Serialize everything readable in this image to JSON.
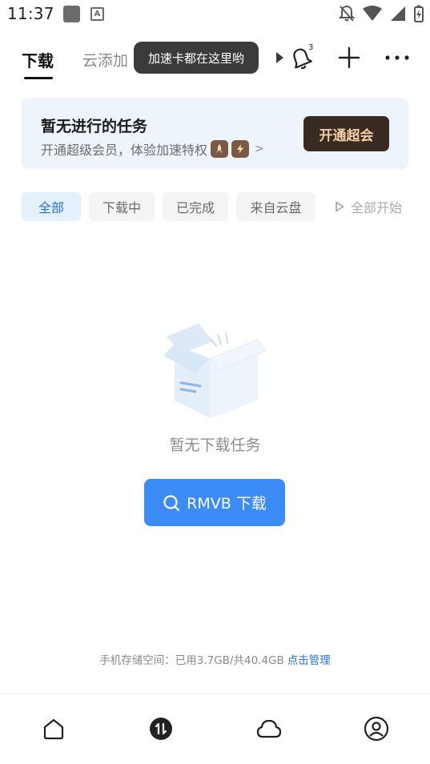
{
  "status_bar": {
    "time": "11:37",
    "app_icon_label": "A"
  },
  "tabs": {
    "active_label": "下载",
    "second_label": "云添加",
    "tooltip": "加速卡都在这里哟",
    "notification_count": "3"
  },
  "vip_banner": {
    "title": "暂无进行的任务",
    "subtitle": "开通超级会员，体验加速特权",
    "arrow": ">",
    "button_label": "开通超会"
  },
  "filters": {
    "items": [
      {
        "label": "全部",
        "active": true
      },
      {
        "label": "下载中",
        "active": false
      },
      {
        "label": "已完成",
        "active": false
      },
      {
        "label": "来自云盘",
        "active": false
      }
    ],
    "start_all_label": "全部开始"
  },
  "empty_state": {
    "message": "暂无下载任务",
    "search_label": "RMVB 下载"
  },
  "storage": {
    "text": "手机存储空间：已用3.7GB/共40.4GB",
    "manage_label": "点击管理"
  },
  "bottom_nav": {
    "items": [
      "home-icon",
      "transfer-icon",
      "cloud-icon",
      "profile-icon"
    ],
    "active_index": 1
  },
  "colors": {
    "accent": "#3c8cf7",
    "active_chip_text": "#2b6fd6",
    "vip_button_bg": "#3a2b22",
    "vip_button_text": "#f2cfa5",
    "banner_bg": "#eef4fb"
  }
}
